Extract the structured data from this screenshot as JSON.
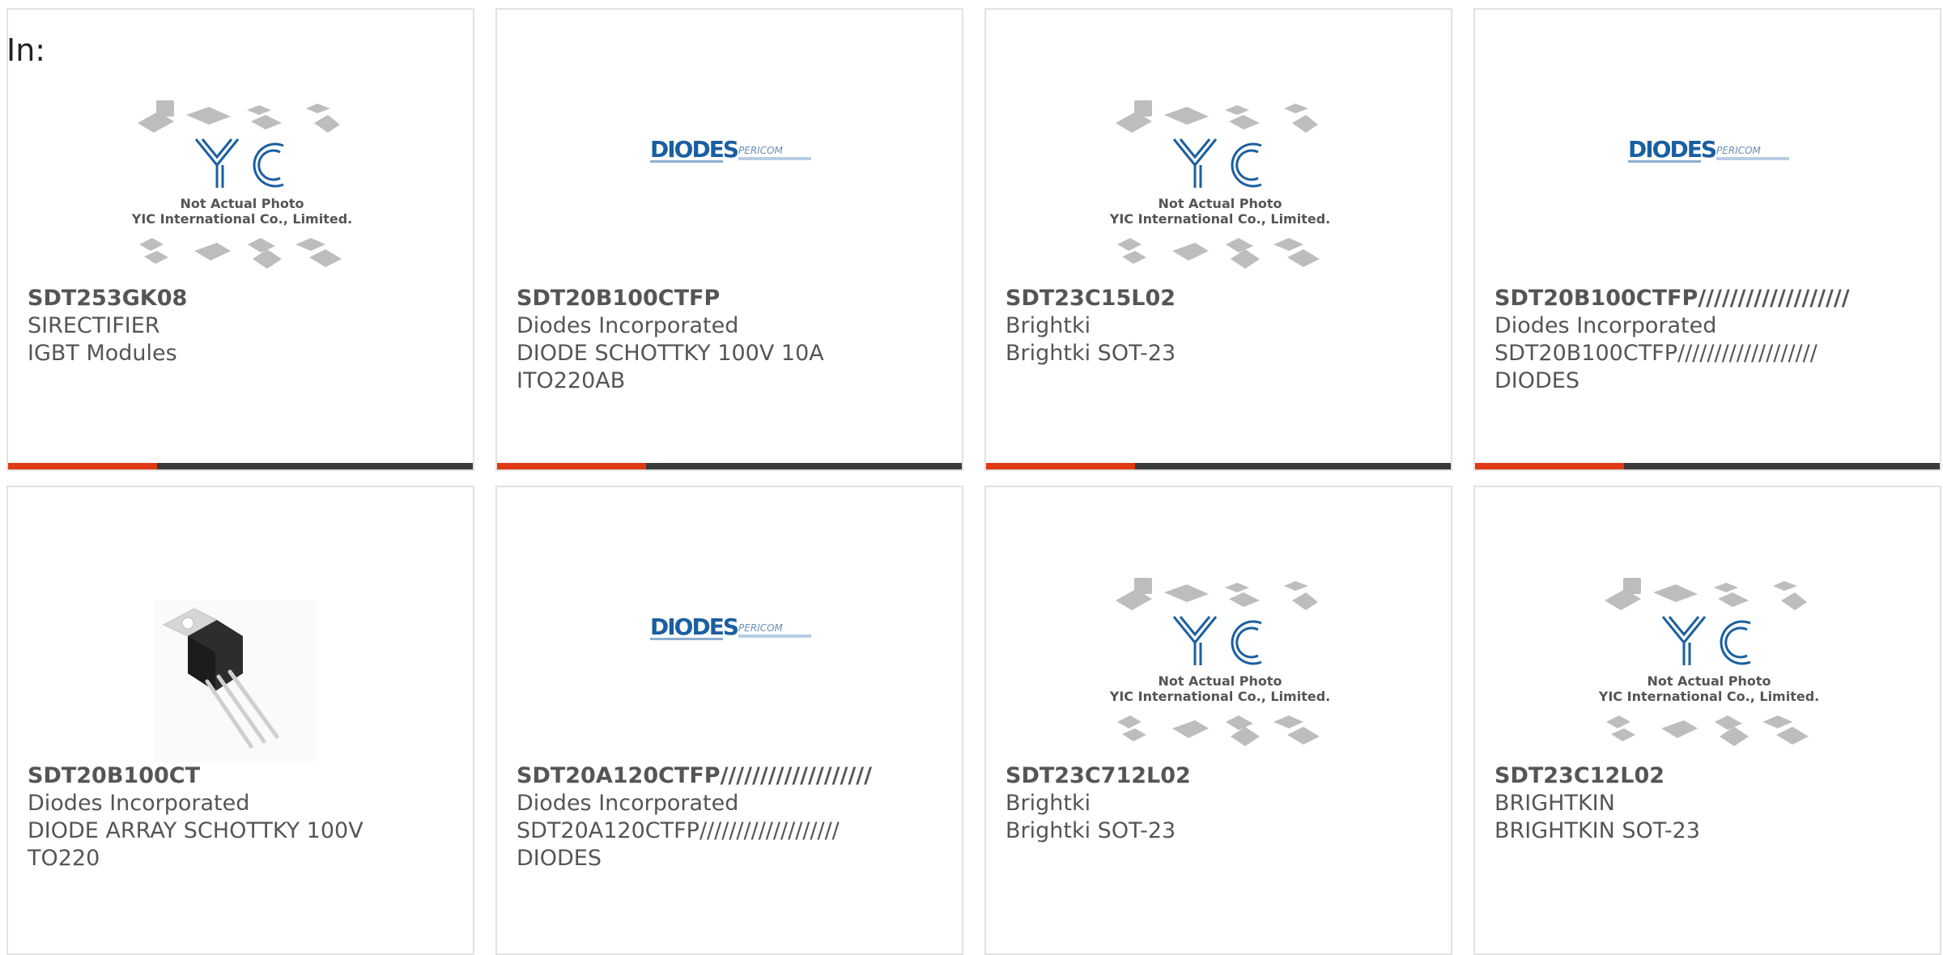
{
  "page": {
    "label": "In:"
  },
  "placeholder_logo": {
    "brand": "YIC",
    "line1": "Not Actual Photo",
    "line2": "YIC International Co., Limited."
  },
  "diodes_logo": {
    "brand": "DIODES",
    "sub": "PERICOM"
  },
  "colors": {
    "accent": "#e03a14",
    "bar": "#3b3b3b",
    "text": "#555555",
    "logo_blue": "#1a5fa0"
  },
  "products": [
    {
      "part": "SDT253GK08",
      "maker": "SIRECTIFIER",
      "desc": "IGBT Modules",
      "image": "yic-placeholder"
    },
    {
      "part": "SDT20B100CTFP",
      "maker": "Diodes Incorporated",
      "desc": "DIODE SCHOTTKY 100V 10A ITO220AB",
      "image": "diodes-logo"
    },
    {
      "part": "SDT23C15L02",
      "maker": "Brightki",
      "desc": "Brightki SOT-23",
      "image": "yic-placeholder"
    },
    {
      "part": "SDT20B100CTFP///////////////////",
      "maker": "Diodes Incorporated",
      "desc": "SDT20B100CTFP/////////////////// DIODES",
      "image": "diodes-logo"
    },
    {
      "part": "SDT20B100CT",
      "maker": "Diodes Incorporated",
      "desc": "DIODE ARRAY SCHOTTKY 100V TO220",
      "image": "to220-photo"
    },
    {
      "part": "SDT20A120CTFP///////////////////",
      "maker": "Diodes Incorporated",
      "desc": "SDT20A120CTFP/////////////////// DIODES",
      "image": "diodes-logo"
    },
    {
      "part": "SDT23C712L02",
      "maker": "Brightki",
      "desc": "Brightki SOT-23",
      "image": "yic-placeholder"
    },
    {
      "part": "SDT23C12L02",
      "maker": "BRIGHTKIN",
      "desc": "BRIGHTKIN SOT-23",
      "image": "yic-placeholder"
    }
  ]
}
